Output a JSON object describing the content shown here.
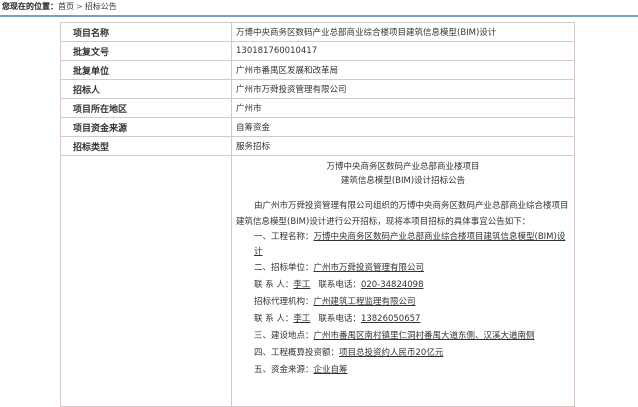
{
  "breadcrumb": {
    "prefix": "您现在的位置：",
    "home": "首页",
    "separator": ">",
    "current": "招标公告"
  },
  "info_rows": [
    {
      "label": "项目名称",
      "value": "万博中央商务区数码产业总部商业综合楼项目建筑信息模型(BIM)设计"
    },
    {
      "label": "批复文号",
      "value": "130181760010417"
    },
    {
      "label": "批复单位",
      "value": "广州市番禺区发展和改革局"
    },
    {
      "label": "招标人",
      "value": "广州市万舜投资管理有限公司"
    },
    {
      "label": "项目所在地区",
      "value": "广州市"
    },
    {
      "label": "项目资金来源",
      "value": "自筹资金"
    },
    {
      "label": "招标类型",
      "value": "服务招标"
    }
  ],
  "notice": {
    "title_line1": "万博中央商务区数码产业总部商业楼项目",
    "title_line2": "建筑信息模型(BIM)设计招标公告",
    "intro": "由广州市万舜投资管理有限公司组织的万博中央商务区数码产业总部商业综合楼项目建筑信息模型(BIM)设计进行公开招标，现将本项目招标的具体事宜公告如下：",
    "item1_label": "一、工程名称：",
    "item1_value": "万博中央商务区数码产业总部商业综合楼项目建筑信息模型(BIM)设计",
    "item2_label": "二、招标单位：",
    "item2_value": "广州市万舜投资管理有限公司",
    "contact_label": "联 系 人：",
    "contact_value": "李工",
    "phone_label": "联系电话：",
    "phone_value": "020-34824098",
    "agent_label": "招标代理机构：",
    "agent_value": "广州建筑工程监理有限公司",
    "contact2_label": "联 系 人：",
    "contact2_value": "李工",
    "phone2_label": "联系电话：",
    "phone2_value": "13826050657",
    "item3_label": "三、建设地点：",
    "item3_value": "广州市番禺区南村镇里仁洞村番禺大道东侧、汉溪大道南侧",
    "item4_label": "四、工程概算投资额：",
    "item4_value": "项目总投资约人民币20亿元",
    "item5_label": "五、资金来源：",
    "item5_value": "企业自筹"
  }
}
